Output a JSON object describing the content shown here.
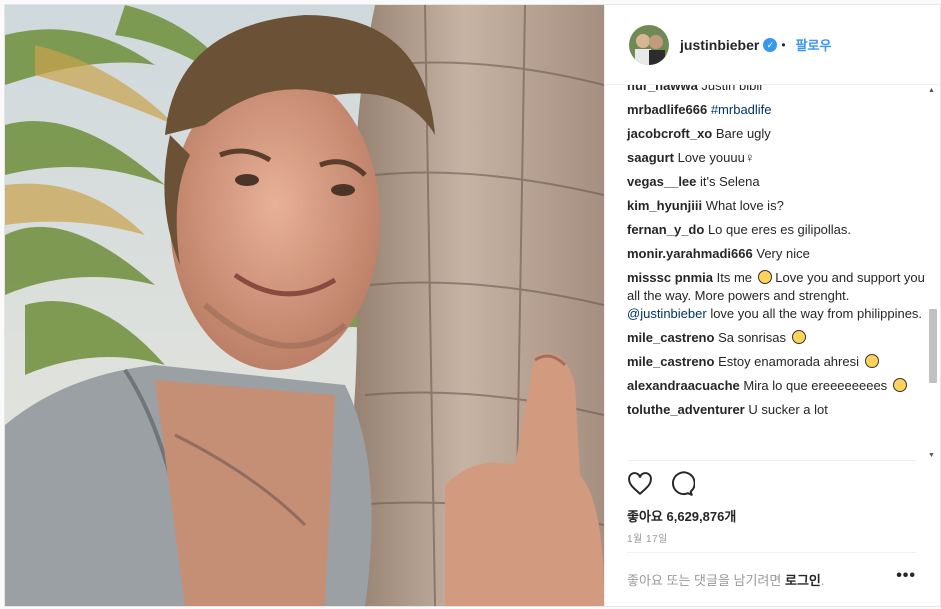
{
  "header": {
    "username": "justinbieber",
    "separator": "•",
    "follow": "팔로우"
  },
  "comments": [
    {
      "user": "nur_nawwa",
      "text": "Justin bibir",
      "cut": true
    },
    {
      "user": "mrbadlife666",
      "tag": "#mrbadlife"
    },
    {
      "user": "jacobcroft_xo",
      "text": "Bare ugly"
    },
    {
      "user": "saagurt",
      "text": "Love youuu"
    },
    {
      "user": "vegas__lee",
      "text": "it's Selena"
    },
    {
      "user": "kim_hyunjiii",
      "text": "What love is?"
    },
    {
      "user": "fernan_y_do",
      "text": "Lo que eres es gilipollas."
    },
    {
      "user": "monir.yarahmadi666",
      "text": "Very nice"
    },
    {
      "user": "misssc pnmia",
      "text_a": "Its me",
      "text_b": "Love you and support you all the way. More powers and strenght.",
      "tag": "@justinbieber",
      "text_c": "love you all the way from philippines."
    },
    {
      "user": "mile_castreno",
      "text": "Sa sonrisas"
    },
    {
      "user": "mile_castreno",
      "text": "Estoy enamorada ahresi"
    },
    {
      "user": "alexandraacuache",
      "text": "Mira lo que ereeeeeeees"
    },
    {
      "user": "toluthe_adventurer",
      "text": "U sucker a lot"
    }
  ],
  "likes": "좋아요 6,629,876개",
  "date": "1월 17일",
  "login": {
    "prefix": "좋아요 또는 댓글을 남기려면",
    "link": "로그인",
    "suffix": "."
  },
  "more": "•••",
  "icons": {
    "like": "heart-icon",
    "comment": "comment-icon",
    "verified": "verified-badge-icon",
    "more": "more-icon"
  },
  "colors": {
    "link": "#3897f0",
    "tag": "#003569",
    "text": "#262626",
    "muted": "#999999"
  }
}
